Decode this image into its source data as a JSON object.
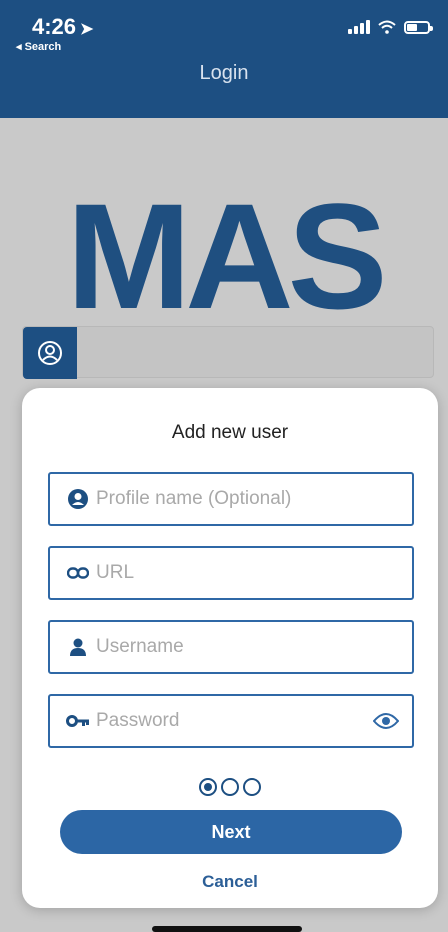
{
  "status_bar": {
    "time": "4:26",
    "location_arrow": "➤",
    "back_label": "◂ Search"
  },
  "header": {
    "title": "Login"
  },
  "logo": {
    "text": "MAS"
  },
  "modal": {
    "title": "Add new user",
    "fields": [
      {
        "icon": "person-circle-icon",
        "placeholder": "Profile name (Optional)"
      },
      {
        "icon": "link-icon",
        "placeholder": "URL"
      },
      {
        "icon": "person-icon",
        "placeholder": "Username"
      },
      {
        "icon": "key-icon",
        "placeholder": "Password"
      }
    ],
    "step": {
      "current": 1,
      "total": 3
    },
    "next_label": "Next",
    "cancel_label": "Cancel"
  },
  "colors": {
    "primary": "#1d4f82",
    "button": "#2c66a5",
    "field_border": "#2f68a6"
  }
}
